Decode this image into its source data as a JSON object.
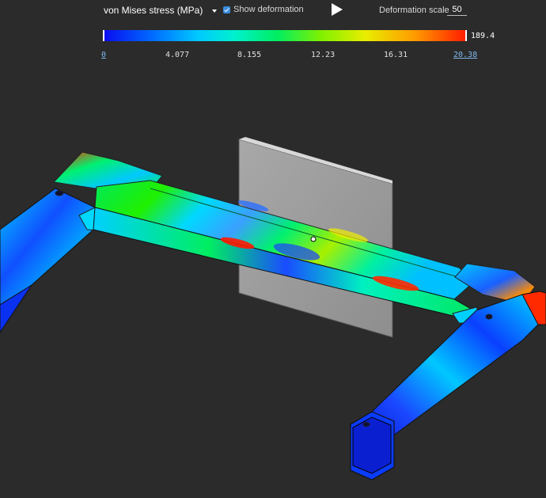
{
  "toolbar": {
    "result_type": "von Mises stress (MPa)",
    "show_deformation_label": "Show deformation",
    "show_deformation_checked": true,
    "deformation_scale_label": "Deformation scale",
    "deformation_scale_value": "50"
  },
  "legend": {
    "max_value": "189.4",
    "ticks": [
      "0",
      "4.077",
      "8.155",
      "12.23",
      "16.31",
      "20.38"
    ],
    "colors": {
      "low": "#0a0af0",
      "mid": "#00ee60",
      "high": "#ff1a00"
    }
  },
  "icons": {
    "result_dropdown": "caret-down-icon",
    "deformation_checkbox": "checkbox-checked-icon",
    "play": "play-icon"
  }
}
